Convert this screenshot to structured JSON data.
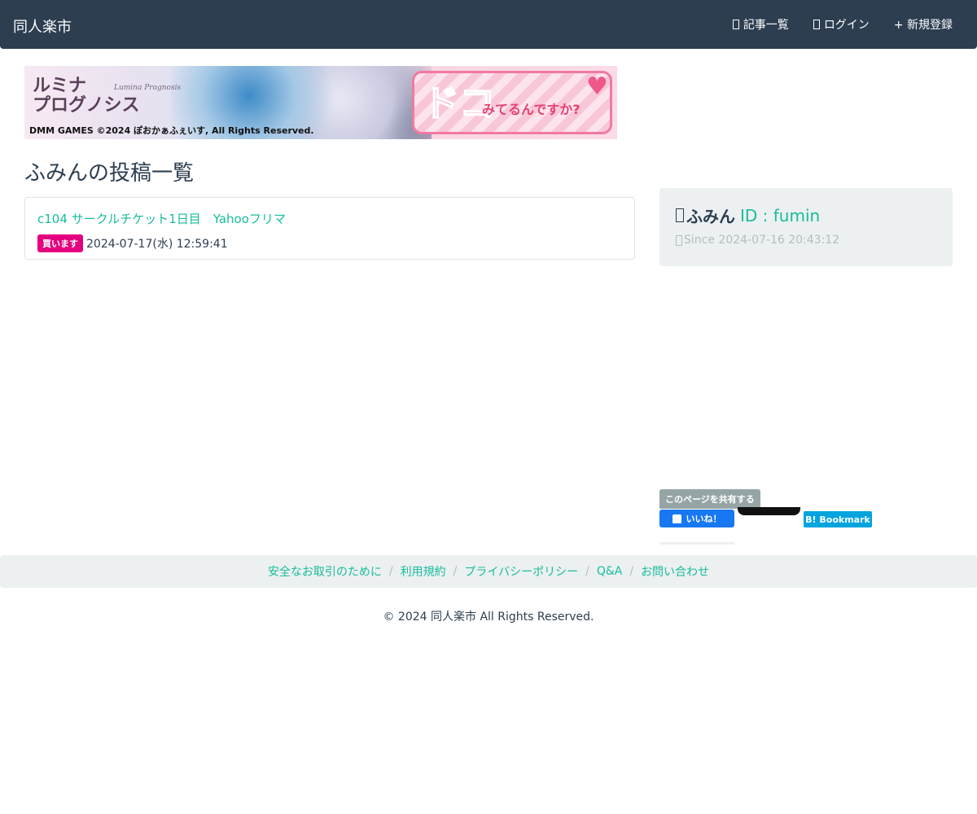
{
  "navbar": {
    "brand": "同人楽市",
    "items": [
      {
        "icon": "list-icon",
        "label": "記事一覧"
      },
      {
        "icon": "login-icon",
        "label": "ログイン"
      },
      {
        "icon": "plus-icon",
        "label": "+ 新規登録"
      }
    ]
  },
  "banner": {
    "logo_text": "ルミナ\nプログノシス",
    "logo_sub": "Lumina Prognosis",
    "headline": "ドコ",
    "catch": "みてるんですか?",
    "copyright": "DMM GAMES  ©2024 ぽおかぁふぇいす, All Rights Reserved."
  },
  "main": {
    "page_title": "ふみんの投稿一覧",
    "posts": [
      {
        "title": "c104 サークルチケット1日目　Yahooフリマ",
        "badge": "買います",
        "date": "2024-07-17(水) 12:59:41"
      }
    ]
  },
  "profile": {
    "name": "ふみん",
    "id_text": "ID : fumin",
    "since": "Since 2024-07-16 20:43:12"
  },
  "share": {
    "label": "このページを共有する",
    "facebook": "いいね！",
    "hatena": "B! Bookmark"
  },
  "footer": {
    "links": [
      "安全なお取引のために",
      "利用規約",
      "プライバシーポリシー",
      "Q&A",
      "お問い合わせ"
    ],
    "copyright": "© 2024 同人楽市 All Rights Reserved."
  },
  "colors": {
    "navbar_bg": "#2c3e50",
    "accent": "#18bc9c",
    "badge_bg": "#e5007f",
    "panel_bg": "#ecf0f1"
  }
}
